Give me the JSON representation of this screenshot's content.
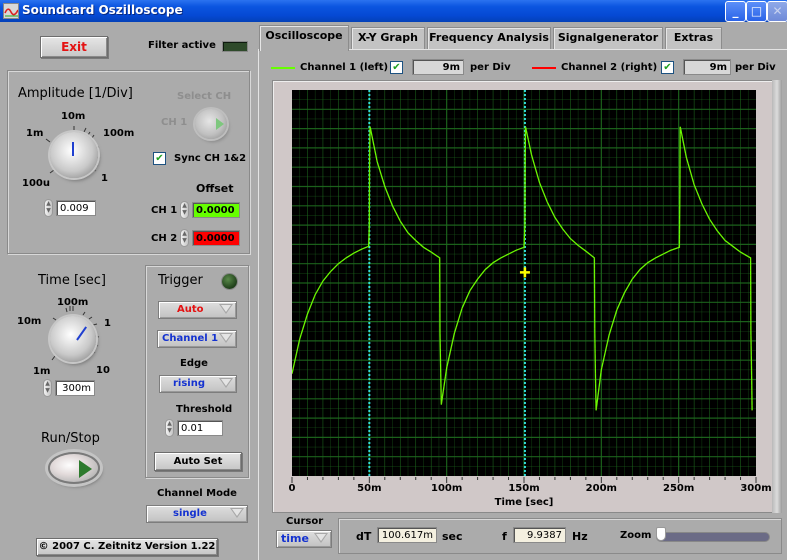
{
  "window": {
    "title": "Soundcard Oszilloscope",
    "controls": [
      "minimize-icon",
      "maximize-icon",
      "close-icon"
    ]
  },
  "left_panel": {
    "exit_label": "Exit",
    "filter_label": "Filter active",
    "filter_led_color": "#2e4a2a",
    "amplitude": {
      "title": "Amplitude [1/Div]",
      "ticks": [
        "100u",
        "1m",
        "10m",
        "100m",
        "1"
      ],
      "value": "0.009"
    },
    "select_ch": {
      "title": "Select CH",
      "label": "CH 1"
    },
    "sync": {
      "label": "Sync CH 1&2",
      "checked": true
    },
    "offset": {
      "title": "Offset",
      "ch1_label": "CH 1",
      "ch1_value": "0.0000",
      "ch1_color": "#66ff00",
      "ch2_label": "CH 2",
      "ch2_value": "0.0000",
      "ch2_color": "#ff0000"
    },
    "time": {
      "title": "Time [sec]",
      "ticks": [
        "1m",
        "10m",
        "100m",
        "1",
        "10"
      ],
      "value": "300m"
    },
    "run_stop_label": "Run/Stop",
    "trigger": {
      "title": "Trigger",
      "mode": "Auto",
      "source": "Channel 1",
      "edge_label": "Edge",
      "edge": "rising",
      "threshold_label": "Threshold",
      "threshold": "0.01",
      "auto_set_label": "Auto Set"
    },
    "channel_mode": {
      "label": "Channel Mode",
      "value": "single"
    },
    "copyright": "© 2007   C. Zeitnitz Version 1.22"
  },
  "tabs": [
    {
      "label": "Oscilloscope",
      "active": true
    },
    {
      "label": "X-Y Graph",
      "active": false
    },
    {
      "label": "Frequency Analysis",
      "active": false
    },
    {
      "label": "Signalgenerator",
      "active": false
    },
    {
      "label": "Extras",
      "active": false
    }
  ],
  "channels": {
    "ch1": {
      "label": "Channel 1 (left)",
      "checked": true,
      "per_div": "9m",
      "per_div_unit": "per Div",
      "color": "#66ff00"
    },
    "ch2": {
      "label": "Channel 2 (right)",
      "checked": true,
      "per_div": "9m",
      "per_div_unit": "per Div",
      "color": "#ff0000"
    }
  },
  "bottom": {
    "cursor_label": "Cursor",
    "cursor_mode": "time",
    "dT_label": "dT",
    "dT_value": "100.617m",
    "dT_unit": "sec",
    "f_label": "f",
    "f_value": "9.9387",
    "f_unit": "Hz",
    "zoom_label": "Zoom",
    "zoom_level": 0
  },
  "chart_data": {
    "type": "line",
    "xlabel": "Time [sec]",
    "ylabel": "",
    "xlim": [
      0,
      0.3
    ],
    "ylim": [
      -10,
      10
    ],
    "x_ticks": [
      0,
      0.05,
      0.1,
      0.15,
      0.2,
      0.25,
      0.3
    ],
    "x_tick_labels": [
      "0",
      "50m",
      "100m",
      "150m",
      "200m",
      "250m",
      "300m"
    ],
    "grid": true,
    "background": "#000000",
    "grid_color": "#1f6b1f",
    "cursors": [
      {
        "name": "cursor-1",
        "x": 0.05,
        "color": "#33dddd"
      },
      {
        "name": "cursor-2",
        "x": 0.1506,
        "color": "#33dddd"
      }
    ],
    "cursor_marker": {
      "x": 0.1506,
      "y": 0.55,
      "color": "#ffff00"
    },
    "series": [
      {
        "name": "Channel 1 (left)",
        "color": "#66ff00",
        "period": 0.1006,
        "segments_description": "rising edge jump then exponential decay, falling edge drop then exponential recovery",
        "points": [
          [
            0.0,
            -4.7
          ],
          [
            0.005,
            -2.9
          ],
          [
            0.01,
            -1.6
          ],
          [
            0.015,
            -0.6
          ],
          [
            0.02,
            0.1
          ],
          [
            0.025,
            0.6
          ],
          [
            0.03,
            1.0
          ],
          [
            0.035,
            1.3
          ],
          [
            0.04,
            1.55
          ],
          [
            0.045,
            1.75
          ],
          [
            0.0495,
            1.9
          ],
          [
            0.05,
            3.0
          ],
          [
            0.0502,
            6.5
          ],
          [
            0.0505,
            8.1
          ],
          [
            0.055,
            6.3
          ],
          [
            0.06,
            5.0
          ],
          [
            0.065,
            4.0
          ],
          [
            0.07,
            3.2
          ],
          [
            0.075,
            2.6
          ],
          [
            0.08,
            2.2
          ],
          [
            0.085,
            1.85
          ],
          [
            0.09,
            1.6
          ],
          [
            0.0955,
            1.3
          ],
          [
            0.0957,
            -2.6
          ],
          [
            0.0962,
            -4.9
          ],
          [
            0.0965,
            -6.3
          ],
          [
            0.1,
            -4.4
          ],
          [
            0.105,
            -2.6
          ],
          [
            0.11,
            -1.3
          ],
          [
            0.115,
            -0.4
          ],
          [
            0.12,
            0.2
          ],
          [
            0.125,
            0.7
          ],
          [
            0.13,
            1.05
          ],
          [
            0.135,
            1.3
          ],
          [
            0.14,
            1.5
          ],
          [
            0.145,
            1.7
          ],
          [
            0.15,
            1.85
          ],
          [
            0.1506,
            3.0
          ],
          [
            0.1508,
            6.5
          ],
          [
            0.151,
            8.1
          ],
          [
            0.155,
            6.6
          ],
          [
            0.16,
            5.2
          ],
          [
            0.165,
            4.2
          ],
          [
            0.17,
            3.4
          ],
          [
            0.175,
            2.8
          ],
          [
            0.18,
            2.3
          ],
          [
            0.185,
            1.95
          ],
          [
            0.19,
            1.65
          ],
          [
            0.1955,
            1.3
          ],
          [
            0.1958,
            -2.6
          ],
          [
            0.1962,
            -4.9
          ],
          [
            0.1966,
            -6.6
          ],
          [
            0.2,
            -4.5
          ],
          [
            0.205,
            -2.7
          ],
          [
            0.21,
            -1.4
          ],
          [
            0.215,
            -0.5
          ],
          [
            0.22,
            0.2
          ],
          [
            0.225,
            0.7
          ],
          [
            0.23,
            1.05
          ],
          [
            0.235,
            1.3
          ],
          [
            0.24,
            1.5
          ],
          [
            0.245,
            1.7
          ],
          [
            0.2505,
            1.85
          ],
          [
            0.2508,
            5.0
          ],
          [
            0.251,
            8.1
          ],
          [
            0.255,
            6.5
          ],
          [
            0.26,
            5.1
          ],
          [
            0.265,
            4.1
          ],
          [
            0.27,
            3.3
          ],
          [
            0.275,
            2.7
          ],
          [
            0.28,
            2.2
          ],
          [
            0.285,
            1.9
          ],
          [
            0.29,
            1.6
          ],
          [
            0.2965,
            1.3
          ],
          [
            0.2967,
            -2.6
          ],
          [
            0.2972,
            -5.0
          ],
          [
            0.2975,
            -6.6
          ]
        ]
      }
    ]
  }
}
